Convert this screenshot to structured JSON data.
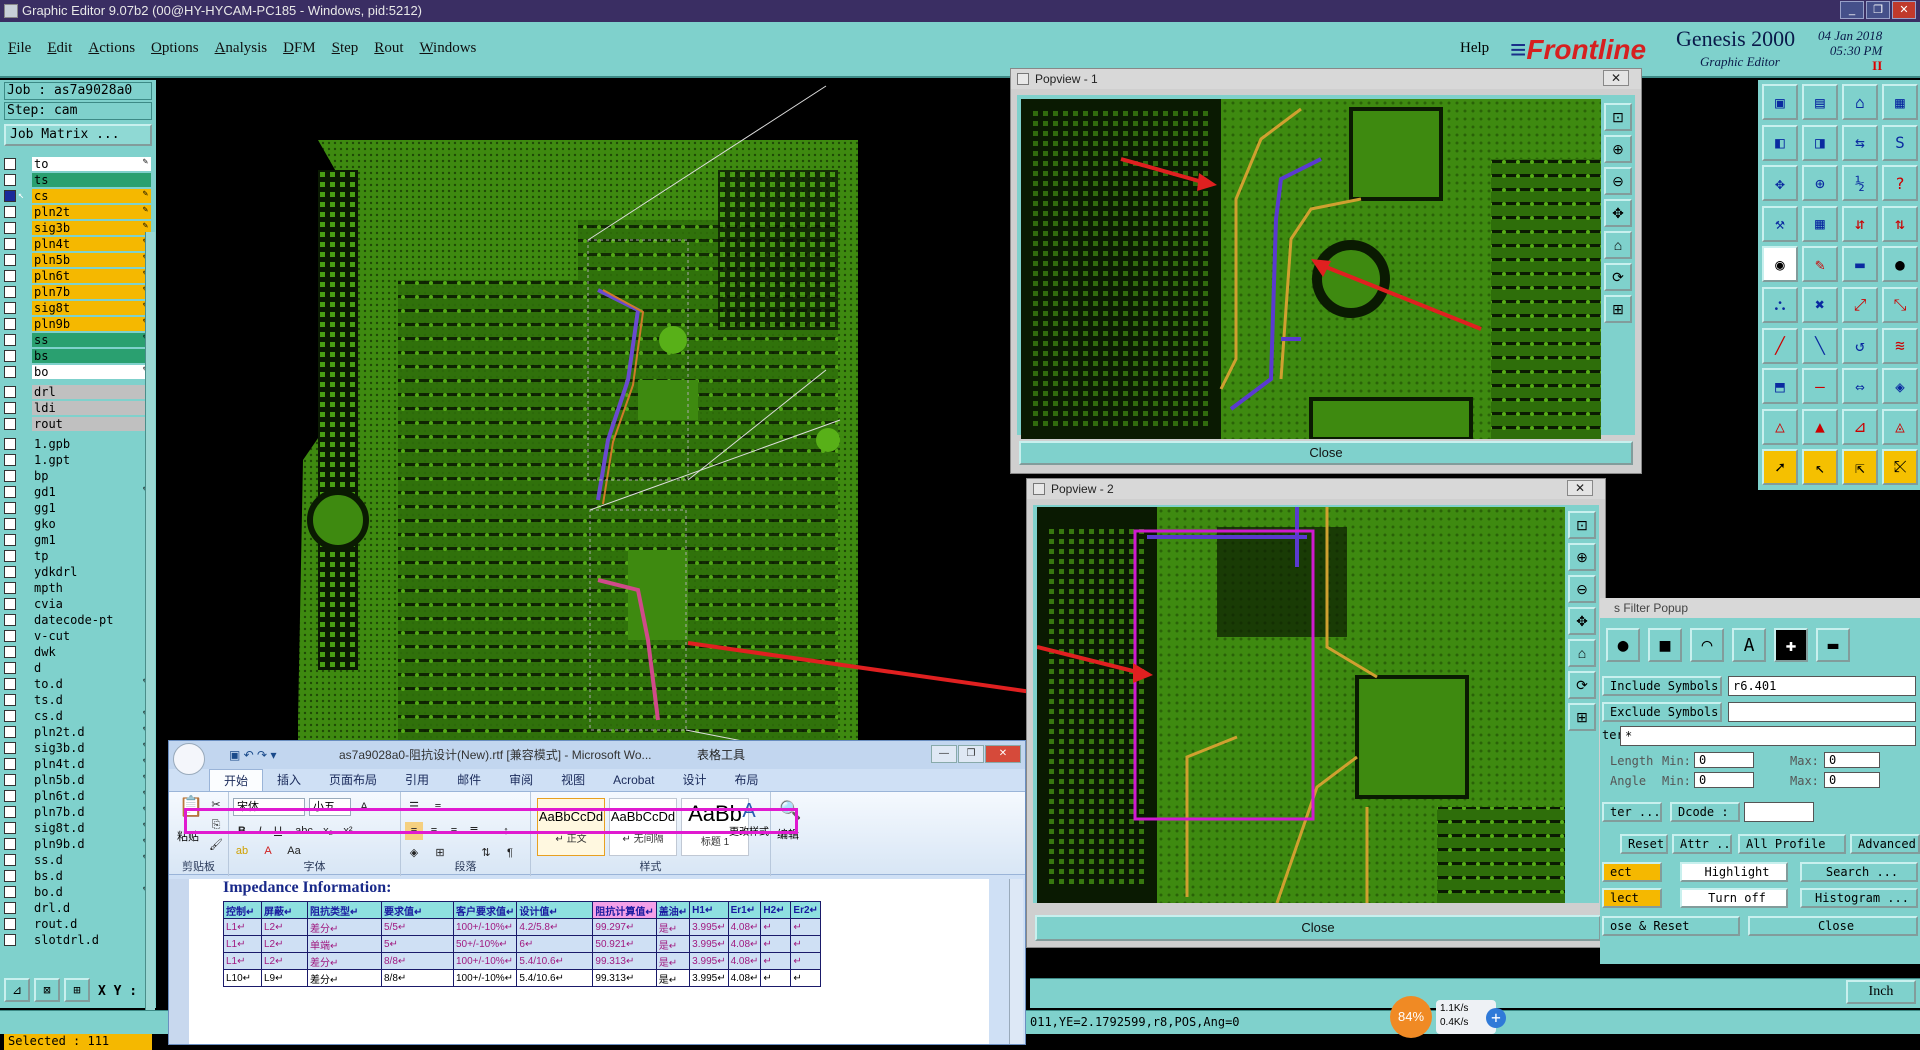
{
  "window": {
    "title": "Graphic Editor 9.07b2 (00@HY-HYCAM-PC185 - Windows, pid:5212)",
    "controls": [
      "_",
      "❐",
      "✕"
    ]
  },
  "menu": {
    "items": [
      "File",
      "Edit",
      "Actions",
      "Options",
      "Analysis",
      "DFM",
      "Step",
      "Rout",
      "Windows"
    ],
    "help": "Help"
  },
  "brand": {
    "logo": "Frontline",
    "product": "Genesis 2000",
    "subtitle": "Graphic Editor",
    "date": "04 Jan 2018",
    "time": "05:30 PM"
  },
  "left": {
    "job": "Job : as7a9028a0",
    "step": "Step: cam",
    "job_matrix": "Job Matrix ...",
    "selected": "Selected : 111",
    "xy_label": "X Y :",
    "layers_group1": [
      {
        "name": "to",
        "color": "#ffffff",
        "pen": true
      },
      {
        "name": "ts",
        "color": "#2aa070",
        "pen": false
      },
      {
        "name": "cs",
        "color": "#f5b800",
        "pen": true,
        "active": true
      },
      {
        "name": "pln2t",
        "color": "#f5b800",
        "pen": true
      },
      {
        "name": "sig3b",
        "color": "#f5b800",
        "pen": true
      },
      {
        "name": "pln4t",
        "color": "#f5b800",
        "pen": true
      },
      {
        "name": "pln5b",
        "color": "#f5b800",
        "pen": true
      },
      {
        "name": "pln6t",
        "color": "#f5b800",
        "pen": true
      },
      {
        "name": "pln7b",
        "color": "#f5b800",
        "pen": true
      },
      {
        "name": "sig8t",
        "color": "#f5b800",
        "pen": true
      },
      {
        "name": "pln9b",
        "color": "#f5b800",
        "pen": true
      },
      {
        "name": "ss",
        "color": "#2aa070",
        "pen": true
      },
      {
        "name": "bs",
        "color": "#2aa070",
        "pen": false
      },
      {
        "name": "bo",
        "color": "#ffffff",
        "pen": true
      }
    ],
    "layers_group2": [
      {
        "name": "drl",
        "color": "#c0c0c0",
        "pen": false
      },
      {
        "name": "ldi",
        "color": "#c0c0c0",
        "pen": false
      },
      {
        "name": "rout",
        "color": "#c0c0c0",
        "pen": false
      }
    ],
    "layers_group3": [
      {
        "name": "1.gpb",
        "color": "#7fd1cc",
        "pen": false
      },
      {
        "name": "1.gpt",
        "color": "#7fd1cc",
        "pen": false
      },
      {
        "name": "bp",
        "color": "#7fd1cc",
        "pen": false
      },
      {
        "name": "gd1",
        "color": "#7fd1cc",
        "pen": true
      },
      {
        "name": "gg1",
        "color": "#7fd1cc",
        "pen": false
      },
      {
        "name": "gko",
        "color": "#7fd1cc",
        "pen": false
      },
      {
        "name": "gm1",
        "color": "#7fd1cc",
        "pen": false
      },
      {
        "name": "tp",
        "color": "#7fd1cc",
        "pen": false
      },
      {
        "name": "ydkdrl",
        "color": "#7fd1cc",
        "pen": false
      },
      {
        "name": "mpth",
        "color": "#7fd1cc",
        "pen": false
      },
      {
        "name": "cvia",
        "color": "#7fd1cc",
        "pen": false
      },
      {
        "name": "datecode-pt",
        "color": "#7fd1cc",
        "pen": false
      },
      {
        "name": "v-cut",
        "color": "#7fd1cc",
        "pen": false
      },
      {
        "name": "dwk",
        "color": "#7fd1cc",
        "pen": false
      },
      {
        "name": "d",
        "color": "#7fd1cc",
        "pen": false
      },
      {
        "name": "to.d",
        "color": "#7fd1cc",
        "pen": true
      },
      {
        "name": "ts.d",
        "color": "#7fd1cc",
        "pen": false
      },
      {
        "name": "cs.d",
        "color": "#7fd1cc",
        "pen": true
      },
      {
        "name": "pln2t.d",
        "color": "#7fd1cc",
        "pen": true
      },
      {
        "name": "sig3b.d",
        "color": "#7fd1cc",
        "pen": true
      },
      {
        "name": "pln4t.d",
        "color": "#7fd1cc",
        "pen": true
      },
      {
        "name": "pln5b.d",
        "color": "#7fd1cc",
        "pen": true
      },
      {
        "name": "pln6t.d",
        "color": "#7fd1cc",
        "pen": true
      },
      {
        "name": "pln7b.d",
        "color": "#7fd1cc",
        "pen": true
      },
      {
        "name": "sig8t.d",
        "color": "#7fd1cc",
        "pen": true
      },
      {
        "name": "pln9b.d",
        "color": "#7fd1cc",
        "pen": true
      },
      {
        "name": "ss.d",
        "color": "#7fd1cc",
        "pen": true
      },
      {
        "name": "bs.d",
        "color": "#7fd1cc",
        "pen": false
      },
      {
        "name": "bo.d",
        "color": "#7fd1cc",
        "pen": true
      },
      {
        "name": "drl.d",
        "color": "#7fd1cc",
        "pen": false
      },
      {
        "name": "rout.d",
        "color": "#7fd1cc",
        "pen": false
      },
      {
        "name": "slotdrl.d",
        "color": "#7fd1cc",
        "pen": false
      }
    ]
  },
  "popview1": {
    "title": "Popview - 1",
    "close": "Close"
  },
  "popview2": {
    "title": "Popview - 2",
    "close": "Close"
  },
  "filter": {
    "title": "s Filter Popup",
    "include_label": "Include Symbols :",
    "include_value": "r6.401",
    "exclude_label": "Exclude Symbols :",
    "exclude_value": "",
    "attr_label": "ter :",
    "attr_value": "*",
    "length_label": "Length",
    "angle_label": "Angle",
    "min_label": "Min:",
    "max_label": "Max:",
    "length_min": "0",
    "length_max": "0",
    "angle_min": "0",
    "angle_max": "0",
    "text_label": "ter ...",
    "dcode_label": "Dcode :",
    "buttons_row1": [
      "Reset",
      "Attr ...",
      "All Profile",
      "Advanced..."
    ],
    "buttons_row2": [
      "ect",
      "Highlight",
      "Search ..."
    ],
    "buttons_row3": [
      "lect",
      "Turn off",
      "Histogram ..."
    ],
    "buttons_row4": [
      "ose & Reset",
      "Close"
    ]
  },
  "status": {
    "coords": "011,YE=2.1792599,r8,POS,Ang=0",
    "units": "Inch",
    "speed_percent": "84%",
    "up_rate": "1.1K/s",
    "down_rate": "0.4K/s"
  },
  "word": {
    "title": "as7a9028a0-阻抗设计(New).rtf [兼容模式] - Microsoft Wo...",
    "tools_tab": "表格工具",
    "tabs": [
      "开始",
      "插入",
      "页面布局",
      "引用",
      "邮件",
      "审阅",
      "视图",
      "Acrobat",
      "设计",
      "布局"
    ],
    "font_name": "宋体",
    "font_size": "小五",
    "group_clipboard": "剪贴板",
    "group_font": "字体",
    "group_paragraph": "段落",
    "group_styles": "样式",
    "paste": "粘贴",
    "change_styles": "更改样式",
    "edit": "编辑",
    "styles": [
      {
        "sample": "AaBbCcDd",
        "name": "↵ 正文"
      },
      {
        "sample": "AaBbCcDd",
        "name": "↵ 无间隔"
      },
      {
        "sample": "AaBb",
        "name": "标题 1"
      }
    ],
    "doc_heading": "Impedance Information:",
    "table_header": [
      "控制↵",
      "屏蔽↵",
      "阻抗类型↵",
      "要求值↵",
      "客户要求值↵",
      "设计值↵",
      "阻抗计算值↵",
      "盖油↵",
      "H1↵",
      "Er1↵",
      "H2↵",
      "Er2↵"
    ],
    "table_rows": [
      [
        "L1↵",
        "L2↵",
        "差分↵",
        "5/5↵",
        "100+/-10%↵",
        "4.2/5.8↵",
        "99.297↵",
        "是↵",
        "3.995↵",
        "4.08↵",
        "↵",
        "↵"
      ],
      [
        "L1↵",
        "L2↵",
        "单端↵",
        "5↵",
        "50+/-10%↵",
        "6↵",
        "50.921↵",
        "是↵",
        "3.995↵",
        "4.08↵",
        "↵",
        "↵"
      ],
      [
        "L1↵",
        "L2↵",
        "差分↵",
        "8/8↵",
        "100+/-10%↵",
        "5.4/10.6↵",
        "99.313↵",
        "是↵",
        "3.995↵",
        "4.08↵",
        "↵",
        "↵"
      ],
      [
        "L10↵",
        "L9↵",
        "差分↵",
        "8/8↵",
        "100+/-10%↵",
        "5.4/10.6↵",
        "99.313↵",
        "是↵",
        "3.995↵",
        "4.08↵",
        "↵",
        "↵"
      ]
    ]
  }
}
